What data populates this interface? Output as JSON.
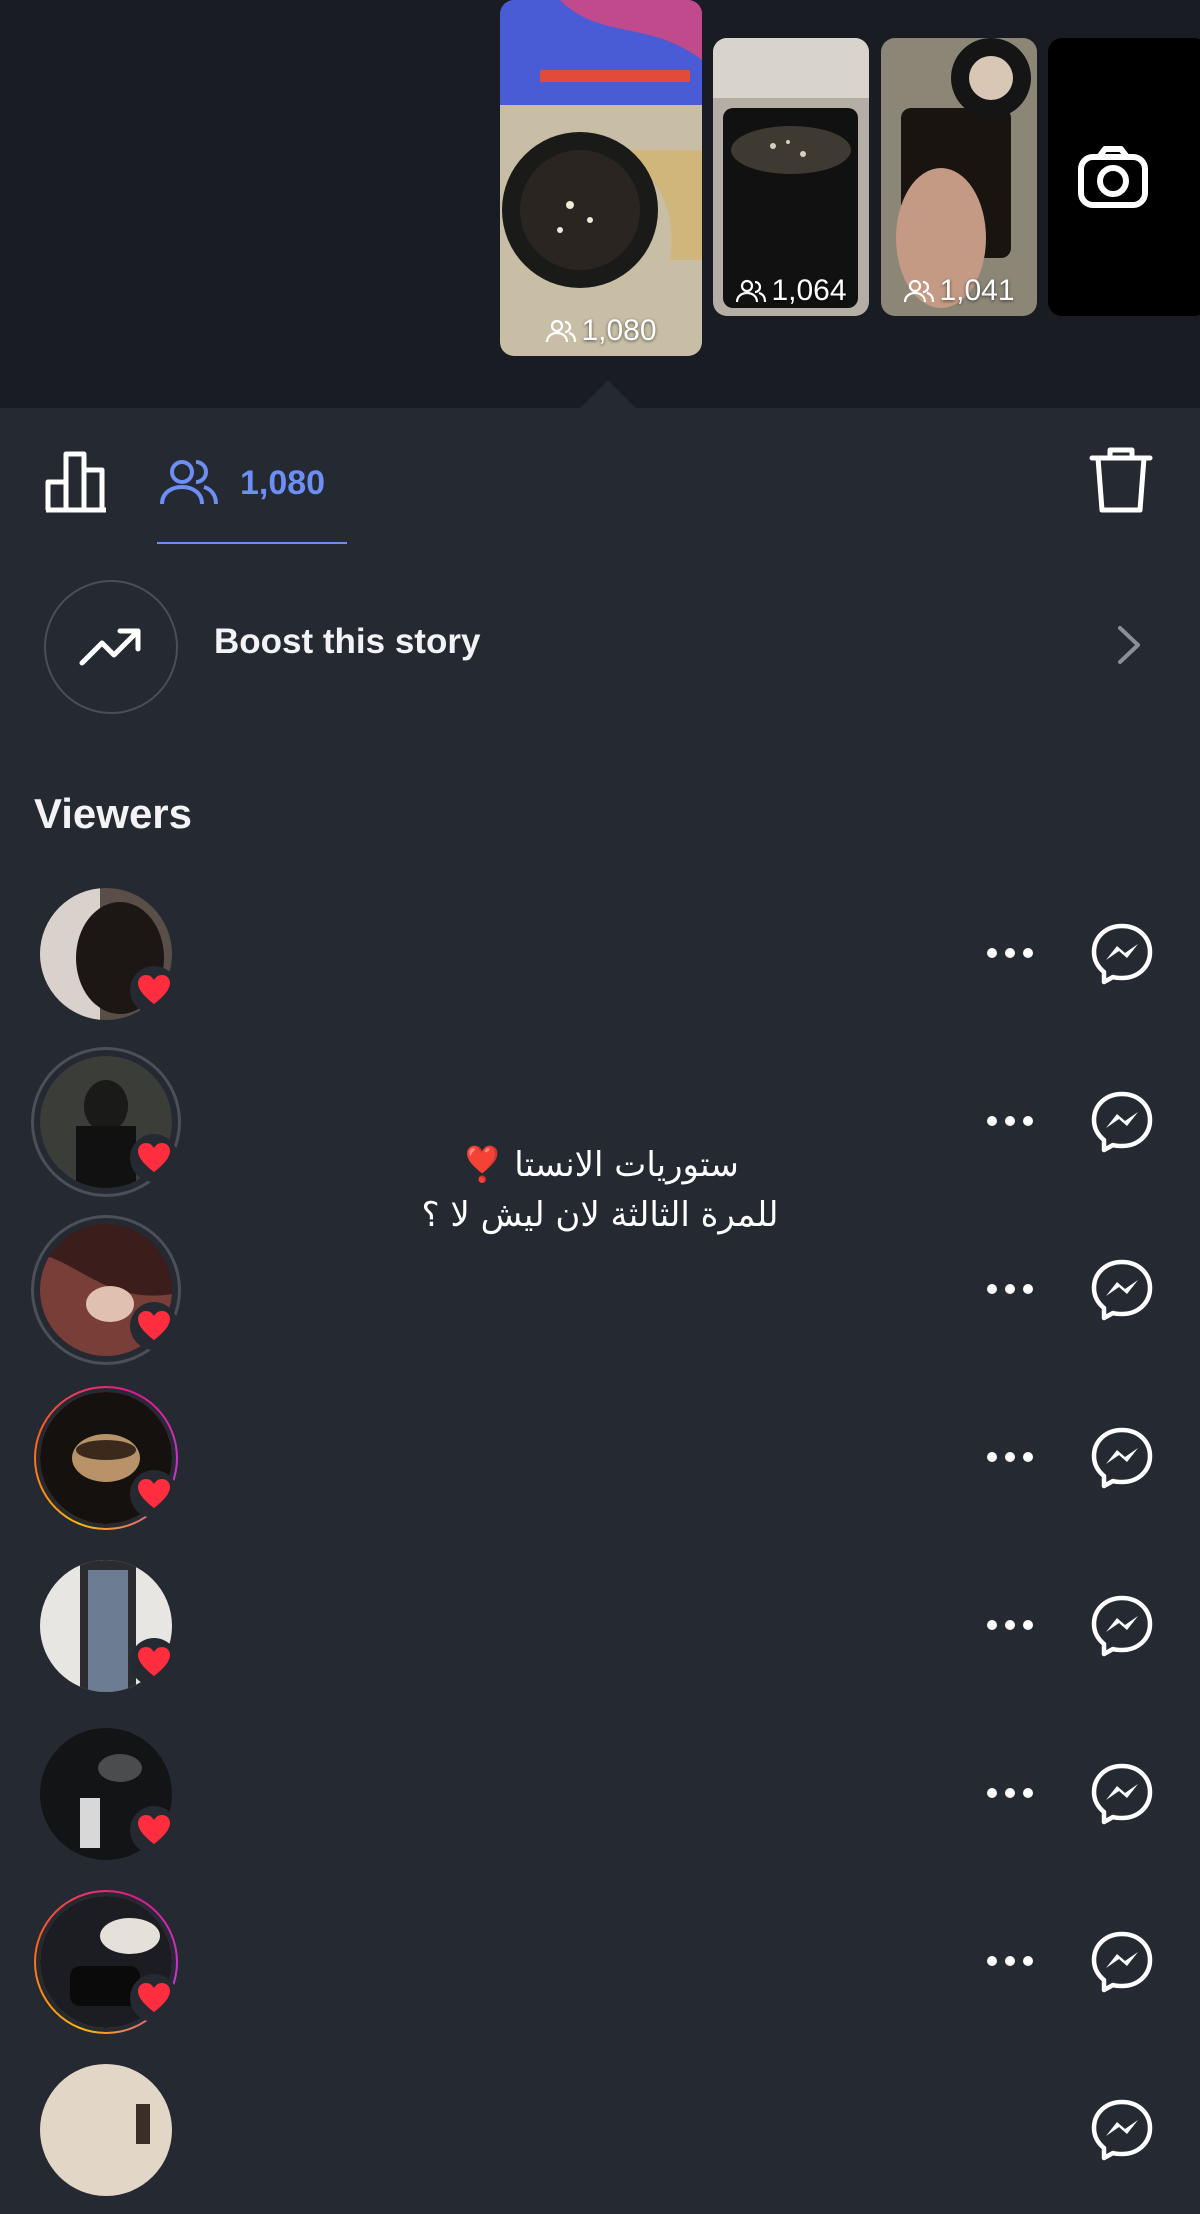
{
  "stories": [
    {
      "views": "1,080"
    },
    {
      "views": "1,064"
    },
    {
      "views": "1,041"
    }
  ],
  "toolbar": {
    "viewer_count": "1,080"
  },
  "boost": {
    "label": "Boost this story"
  },
  "viewers_section": {
    "title": "Viewers"
  },
  "overlay": {
    "line1": "ستوريات الانستا ❣️",
    "line2": "للمرة الثالثة لان ليش لا ؟"
  },
  "colors": {
    "accent": "#6d8ef2",
    "background": "#252932",
    "strip": "#191c22",
    "heart": "#ff2d3d"
  },
  "icons": [
    "viewers-icon",
    "insights-icon",
    "trash-icon",
    "trend-up-icon",
    "chevron-right-icon",
    "camera-icon",
    "heart-icon",
    "more-icon",
    "messenger-icon"
  ]
}
